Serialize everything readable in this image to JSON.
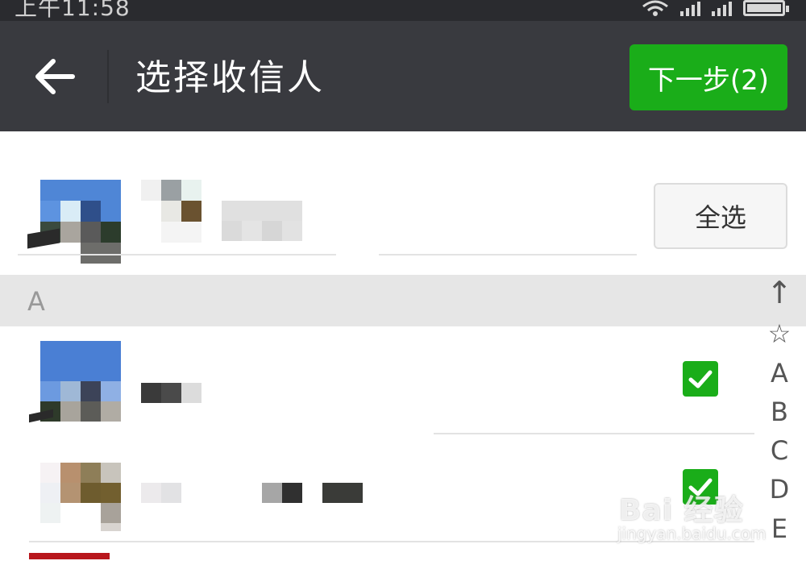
{
  "status_bar": {
    "time": "上午11:58"
  },
  "app_bar": {
    "title": "选择收信人",
    "next_button": "下一步(2)"
  },
  "header": {
    "select_all": "全选"
  },
  "section": {
    "letter": "A"
  },
  "index_bar": [
    "↑",
    "☆",
    "A",
    "B",
    "C",
    "D",
    "E"
  ],
  "contacts": [
    {
      "checked": true
    },
    {
      "checked": true
    }
  ],
  "watermark": {
    "brand": "Bai 经验",
    "url": "jingyan.baidu.com"
  },
  "colors": {
    "app_bar": "#393a3f",
    "accent_green": "#1aad19",
    "section_bg": "#e6e6e6"
  }
}
